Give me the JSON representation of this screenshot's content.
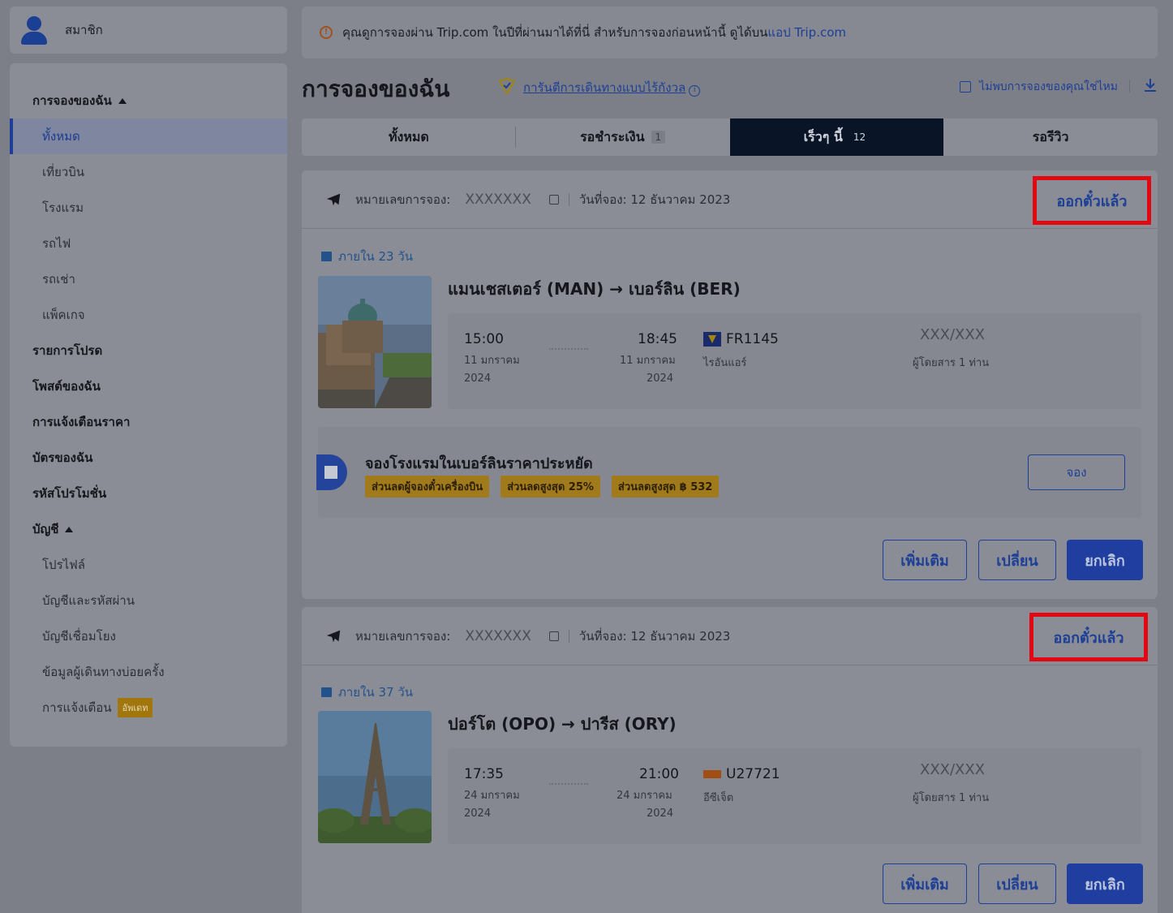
{
  "sidebar": {
    "member_label": "สมาชิก",
    "items": [
      {
        "label": "การจองของฉัน",
        "type": "header",
        "expanded": true
      },
      {
        "label": "ทั้งหมด",
        "type": "sub",
        "active": true
      },
      {
        "label": "เที่ยวบิน",
        "type": "sub"
      },
      {
        "label": "โรงแรม",
        "type": "sub"
      },
      {
        "label": "รถไฟ",
        "type": "sub"
      },
      {
        "label": "รถเช่า",
        "type": "sub"
      },
      {
        "label": "แพ็คเกจ",
        "type": "sub"
      },
      {
        "label": "รายการโปรด",
        "type": "header"
      },
      {
        "label": "โพสต์ของฉัน",
        "type": "header"
      },
      {
        "label": "การแจ้งเตือนราคา",
        "type": "header"
      },
      {
        "label": "บัตรของฉัน",
        "type": "header"
      },
      {
        "label": "รหัสโปรโมชั่น",
        "type": "header"
      },
      {
        "label": "บัญชี",
        "type": "header",
        "expanded": true
      },
      {
        "label": "โปรไฟล์",
        "type": "sub"
      },
      {
        "label": "บัญชีและรหัสผ่าน",
        "type": "sub"
      },
      {
        "label": "บัญชีเชื่อมโยง",
        "type": "sub"
      },
      {
        "label": "ข้อมูลผู้เดินทางบ่อยครั้ง",
        "type": "sub"
      },
      {
        "label": "การแจ้งเตือน",
        "type": "sub",
        "badge": "อัพเดท"
      }
    ]
  },
  "notice": {
    "text": "คุณดูการจองผ่าน Trip.com ในปีที่ผ่านมาได้ที่นี่ สำหรับการจองก่อนหน้านี้ ดูได้บน",
    "link": "แอป Trip.com"
  },
  "header": {
    "title": "การจองของฉัน",
    "guarantee": "การันตีการเดินทางแบบไร้กังวล",
    "find_booking": "ไม่พบการจองของคุณใช่ไหม"
  },
  "tabs": [
    {
      "label": "ทั้งหมด",
      "count": ""
    },
    {
      "label": "รอชำระเงิน",
      "count": "1"
    },
    {
      "label": "เร็วๆ นี้",
      "count": "12",
      "active": true
    },
    {
      "label": "รอรีวิว",
      "count": ""
    }
  ],
  "bookings": [
    {
      "booking_label": "หมายเลขการจอง:",
      "booking_no": "XXXXXXX",
      "booking_date": "วันที่จอง: 12 ธันวาคม 2023",
      "status": "ออกตั๋วแล้ว",
      "within": "ภายใน 23 วัน",
      "route": "แมนเชสเตอร์ (MAN) → เบอร์ลิน (BER)",
      "dep_time": "15:00",
      "dep_date": "11 มกราคม",
      "dep_year": "2024",
      "arr_time": "18:45",
      "arr_date": "11 มกราคม",
      "arr_year": "2024",
      "flight_no": "FR1145",
      "airline": "ไรอันแอร์",
      "seats": "XXX/XXX",
      "pax": "ผู้โดยสาร 1 ท่าน",
      "hotel_promo": {
        "title": "จองโรงแรมในเบอร์ลินราคาประหยัด",
        "tags": [
          "ส่วนลดผู้จองตั๋วเครื่องบิน",
          "ส่วนลดสูงสุด 25%",
          "ส่วนลดสูงสุด ฿ 532"
        ],
        "book_label": "จอง"
      },
      "actions": {
        "more": "เพิ่มเติม",
        "change": "เปลี่ยน",
        "cancel": "ยกเลิก"
      }
    },
    {
      "booking_label": "หมายเลขการจอง:",
      "booking_no": "XXXXXXX",
      "booking_date": "วันที่จอง: 12 ธันวาคม 2023",
      "status": "ออกตั๋วแล้ว",
      "within": "ภายใน 37 วัน",
      "route": "ปอร์โต (OPO) → ปารีส (ORY)",
      "dep_time": "17:35",
      "dep_date": "24 มกราคม",
      "dep_year": "2024",
      "arr_time": "21:00",
      "arr_date": "24 มกราคม",
      "arr_year": "2024",
      "flight_no": "U27721",
      "airline": "อีซีเจ็ต",
      "seats": "XXX/XXX",
      "pax": "ผู้โดยสาร 1 ท่าน",
      "actions": {
        "more": "เพิ่มเติม",
        "change": "เปลี่ยน",
        "cancel": "ยกเลิก"
      }
    }
  ],
  "colors": {
    "accent": "#1e3f96",
    "highlight": "#e30613",
    "active_tab": "#0a1427"
  }
}
